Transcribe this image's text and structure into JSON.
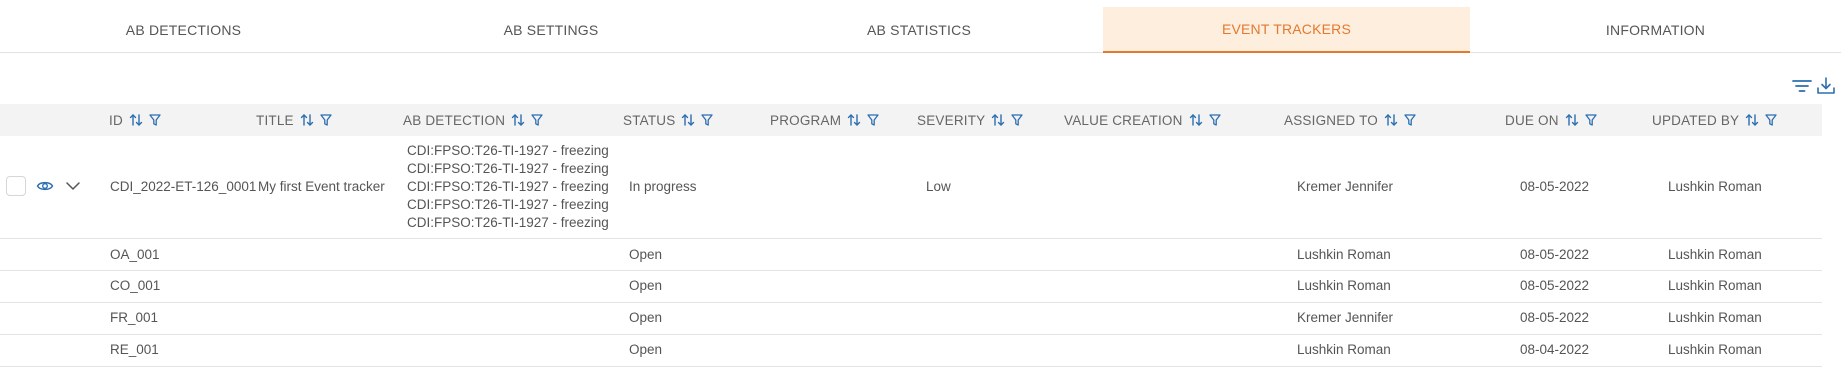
{
  "tabs": [
    {
      "label": "AB DETECTIONS"
    },
    {
      "label": "AB SETTINGS"
    },
    {
      "label": "AB STATISTICS"
    },
    {
      "label": "EVENT TRACKERS",
      "active": true
    },
    {
      "label": "INFORMATION"
    }
  ],
  "toolbar": {
    "filter_icon": "filter-lines-icon",
    "download_icon": "download-icon"
  },
  "columns": {
    "id": "ID",
    "title": "TITLE",
    "ab_detection": "AB DETECTION",
    "status": "STATUS",
    "program": "PROGRAM",
    "severity": "SEVERITY",
    "value_creation": "VALUE CREATION",
    "assigned_to": "ASSIGNED TO",
    "due_on": "DUE ON",
    "updated_by": "UPDATED BY"
  },
  "rows": [
    {
      "id": "CDI_2022-ET-126_0001",
      "title": "My first Event tracker",
      "ab_detection": [
        "CDI:FPSO:T26-TI-1927 - freezing",
        "CDI:FPSO:T26-TI-1927 - freezing",
        "CDI:FPSO:T26-TI-1927 - freezing",
        "CDI:FPSO:T26-TI-1927 - freezing",
        "CDI:FPSO:T26-TI-1927 - freezing"
      ],
      "status": "In progress",
      "severity": "Low",
      "assigned_to": "Kremer Jennifer",
      "due_on": "08-05-2022",
      "updated_by": "Lushkin Roman"
    },
    {
      "id": "OA_001",
      "status": "Open",
      "assigned_to": "Lushkin Roman",
      "due_on": "08-05-2022",
      "updated_by": "Lushkin Roman"
    },
    {
      "id": "CO_001",
      "status": "Open",
      "assigned_to": "Lushkin Roman",
      "due_on": "08-05-2022",
      "updated_by": "Lushkin Roman"
    },
    {
      "id": "FR_001",
      "status": "Open",
      "assigned_to": "Kremer Jennifer",
      "due_on": "08-05-2022",
      "updated_by": "Lushkin Roman"
    },
    {
      "id": "RE_001",
      "status": "Open",
      "assigned_to": "Lushkin Roman",
      "due_on": "08-04-2022",
      "updated_by": "Lushkin Roman"
    }
  ],
  "colors": {
    "accent": "#e4782e",
    "accent_bg": "#fdeedd",
    "icon_blue": "#2c6fb0"
  }
}
